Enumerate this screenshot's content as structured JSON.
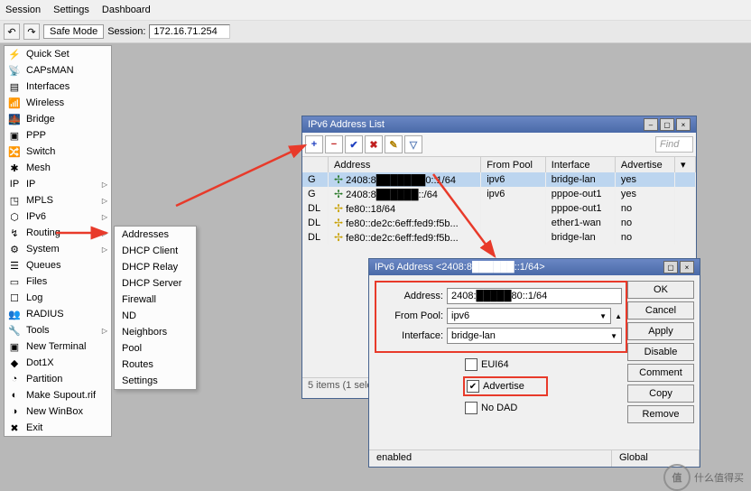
{
  "menubar": [
    "Session",
    "Settings",
    "Dashboard"
  ],
  "toolbar": {
    "safemode": "Safe Mode",
    "session_label": "Session:",
    "session_ip": "172.16.71.254"
  },
  "sidebar": [
    "Quick Set",
    "CAPsMAN",
    "Interfaces",
    "Wireless",
    "Bridge",
    "PPP",
    "Switch",
    "Mesh",
    "IP",
    "MPLS",
    "IPv6",
    "Routing",
    "System",
    "Queues",
    "Files",
    "Log",
    "RADIUS",
    "Tools",
    "New Terminal",
    "Dot1X",
    "Partition",
    "Make Supout.rif",
    "New WinBox",
    "Exit"
  ],
  "submenu": [
    "Addresses",
    "DHCP Client",
    "DHCP Relay",
    "DHCP Server",
    "Firewall",
    "ND",
    "Neighbors",
    "Pool",
    "Routes",
    "Settings"
  ],
  "addrlist": {
    "title": "IPv6 Address List",
    "cols": [
      "Address",
      "From Pool",
      "Interface",
      "Advertise"
    ],
    "rows": [
      {
        "flag": "G",
        "addr": "2408:8███████0::1/64",
        "pool": "ipv6",
        "iface": "bridge-lan",
        "adv": "yes",
        "green": true,
        "sel": true
      },
      {
        "flag": "G",
        "addr": "2408:8██████::/64",
        "pool": "ipv6",
        "iface": "pppoe-out1",
        "adv": "yes",
        "green": true
      },
      {
        "flag": "DL",
        "addr": "fe80::18/64",
        "pool": "",
        "iface": "pppoe-out1",
        "adv": "no"
      },
      {
        "flag": "DL",
        "addr": "fe80::de2c:6eff:fed9:f5b...",
        "pool": "",
        "iface": "ether1-wan",
        "adv": "no"
      },
      {
        "flag": "DL",
        "addr": "fe80::de2c:6eff:fed9:f5b...",
        "pool": "",
        "iface": "bridge-lan",
        "adv": "no"
      }
    ],
    "status": "5 items (1 sele",
    "find": "Find"
  },
  "addrdlg": {
    "title": "IPv6 Address <2408:8██████::1/64>",
    "labels": {
      "addr": "Address:",
      "pool": "From Pool:",
      "iface": "Interface:"
    },
    "vals": {
      "addr": "2408:█████80::1/64",
      "pool": "ipv6",
      "iface": "bridge-lan"
    },
    "checks": {
      "eui64": "EUI64",
      "adv": "Advertise",
      "nodad": "No DAD"
    },
    "btns": [
      "OK",
      "Cancel",
      "Apply",
      "Disable",
      "Comment",
      "Copy",
      "Remove"
    ],
    "status": {
      "left": "enabled",
      "right": "Global"
    }
  },
  "watermark": "什么值得买"
}
